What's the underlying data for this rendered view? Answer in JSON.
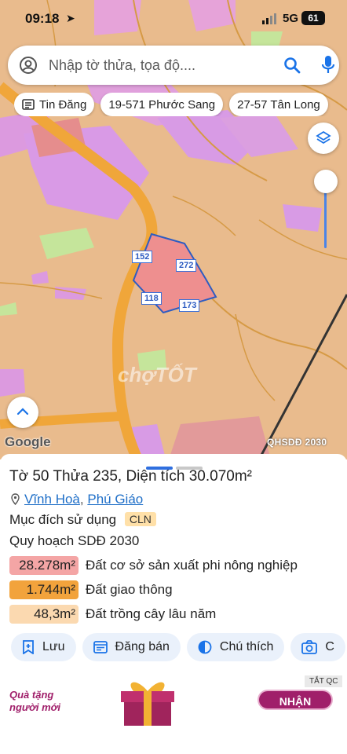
{
  "status_bar": {
    "time": "09:18",
    "network": "5G",
    "battery": "61"
  },
  "search": {
    "placeholder": "Nhập tờ thửa, tọa độ...."
  },
  "chips": [
    {
      "label": "Tin Đăng",
      "icon": "newspaper-icon"
    },
    {
      "label": "19-571 Phước Sang"
    },
    {
      "label": "27-57 Tân Long"
    }
  ],
  "map": {
    "parcel_edges": [
      "152",
      "272",
      "118",
      "173"
    ],
    "attribution": "Google",
    "layer_label": "QHSDĐ 2030",
    "watermark": "chợTỐT"
  },
  "parcel": {
    "title_prefix": "Tờ",
    "sheet": "50",
    "plot_prefix": "Thửa",
    "plot": "235",
    "area_label": ", Diện tích",
    "area": "30.070m²",
    "commune": "Vĩnh Hoà",
    "separator": ",",
    "district": "Phú Giáo",
    "purpose_label": "Mục đích sử dụng",
    "purpose_code": "CLN",
    "plan_label": "Quy hoạch SDĐ 2030",
    "land_uses": [
      {
        "area": "28.278m²",
        "label": "Đất cơ sở sản xuất phi nông nghiệp",
        "color": "#f4a5a5"
      },
      {
        "area": "1.744m²",
        "label": "Đất giao thông",
        "color": "#f2a33c"
      },
      {
        "area": "48,3m²",
        "label": "Đất trồng cây lâu năm",
        "color": "#fbd9b0"
      }
    ]
  },
  "actions": [
    {
      "label": "Lưu",
      "icon": "bookmark-add-icon"
    },
    {
      "label": "Đăng bán",
      "icon": "listing-icon"
    },
    {
      "label": "Chú thích",
      "icon": "contrast-icon"
    },
    {
      "label": "C",
      "icon": "camera-icon"
    }
  ],
  "ad": {
    "tag": "TẮT QC",
    "text_line1": "Quà tặng",
    "text_line2": "người mới",
    "button": "NHẬN"
  }
}
